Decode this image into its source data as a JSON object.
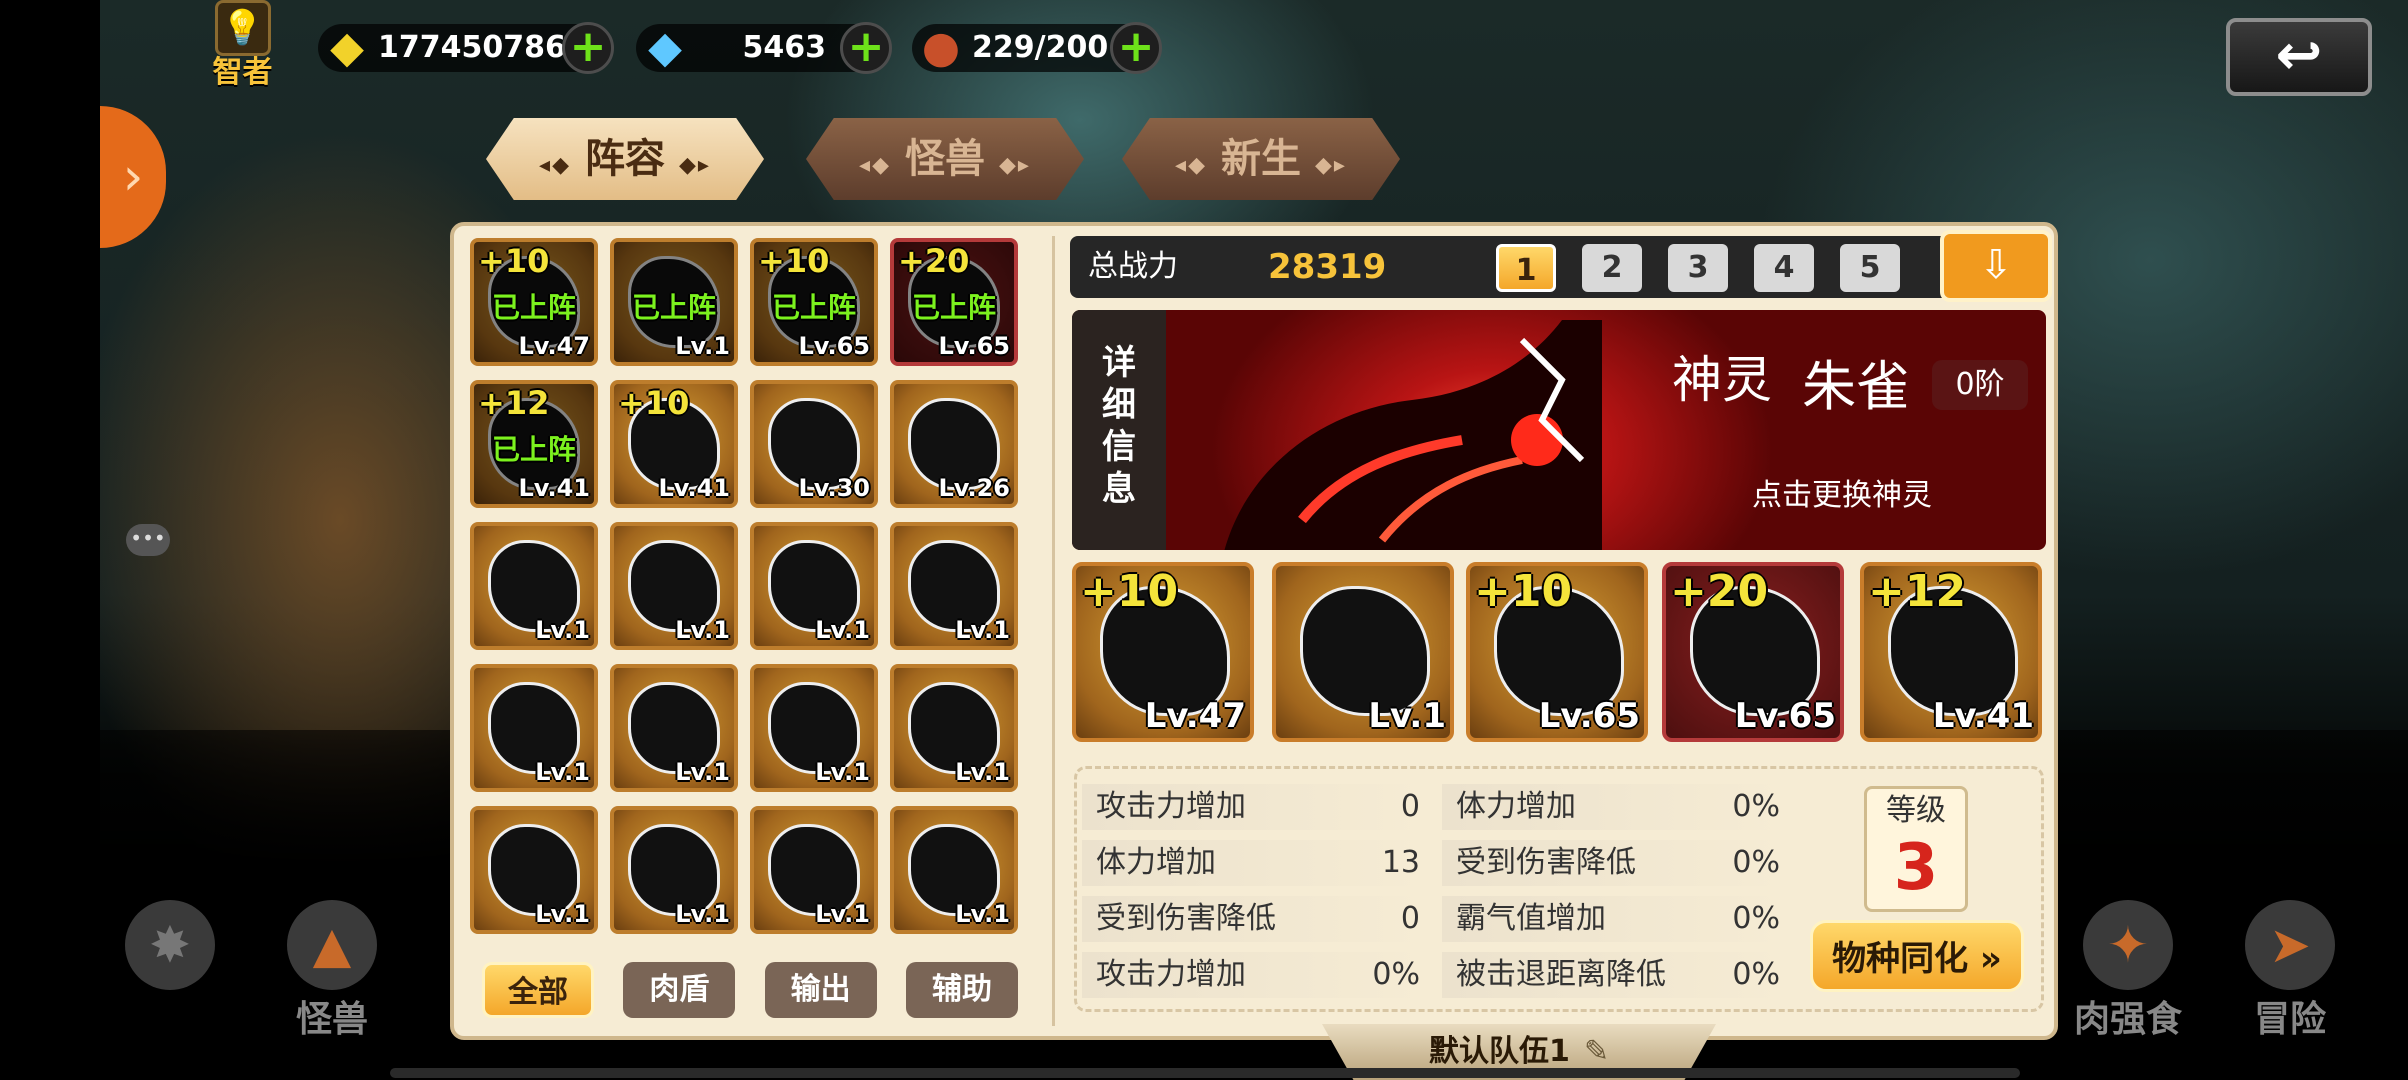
{
  "top": {
    "rank_label": "智者",
    "gold": "177450786",
    "diamonds": "5463",
    "stamina": "229/200"
  },
  "tabs": [
    "阵容",
    "怪兽",
    "新生"
  ],
  "roster": [
    {
      "plus": "+10",
      "lv": "Lv.47",
      "deployed": "已上阵",
      "red": false
    },
    {
      "plus": "",
      "lv": "Lv.1",
      "deployed": "已上阵",
      "red": false
    },
    {
      "plus": "+10",
      "lv": "Lv.65",
      "deployed": "已上阵",
      "red": false
    },
    {
      "plus": "+20",
      "lv": "Lv.65",
      "deployed": "已上阵",
      "red": true
    },
    {
      "plus": "+12",
      "lv": "Lv.41",
      "deployed": "已上阵",
      "red": false
    },
    {
      "plus": "+10",
      "lv": "Lv.41",
      "deployed": "",
      "red": false
    },
    {
      "plus": "",
      "lv": "Lv.30",
      "deployed": "",
      "red": false
    },
    {
      "plus": "",
      "lv": "Lv.26",
      "deployed": "",
      "red": false
    },
    {
      "plus": "",
      "lv": "Lv.1",
      "deployed": "",
      "red": false
    },
    {
      "plus": "",
      "lv": "Lv.1",
      "deployed": "",
      "red": false
    },
    {
      "plus": "",
      "lv": "Lv.1",
      "deployed": "",
      "red": false
    },
    {
      "plus": "",
      "lv": "Lv.1",
      "deployed": "",
      "red": false
    },
    {
      "plus": "",
      "lv": "Lv.1",
      "deployed": "",
      "red": false
    },
    {
      "plus": "",
      "lv": "Lv.1",
      "deployed": "",
      "red": false
    },
    {
      "plus": "",
      "lv": "Lv.1",
      "deployed": "",
      "red": false
    },
    {
      "plus": "",
      "lv": "Lv.1",
      "deployed": "",
      "red": false
    },
    {
      "plus": "",
      "lv": "Lv.1",
      "deployed": "",
      "red": false
    },
    {
      "plus": "",
      "lv": "Lv.1",
      "deployed": "",
      "red": false
    },
    {
      "plus": "",
      "lv": "Lv.1",
      "deployed": "",
      "red": false
    },
    {
      "plus": "",
      "lv": "Lv.1",
      "deployed": "",
      "red": false
    }
  ],
  "filters": [
    "全部",
    "肉盾",
    "输出",
    "辅助"
  ],
  "power": {
    "label": "总战力",
    "value": "28319"
  },
  "team_numbers": [
    "1",
    "2",
    "3",
    "4",
    "5"
  ],
  "spirit": {
    "detail": "详细信息",
    "kind": "神灵",
    "name": "朱雀",
    "stage": "0阶",
    "swap_hint": "点击更换神灵"
  },
  "lineup": [
    {
      "plus": "+10",
      "lv": "Lv.47",
      "red": false
    },
    {
      "plus": "",
      "lv": "Lv.1",
      "red": false
    },
    {
      "plus": "+10",
      "lv": "Lv.65",
      "red": false
    },
    {
      "plus": "+20",
      "lv": "Lv.65",
      "red": true
    },
    {
      "plus": "+12",
      "lv": "Lv.41",
      "red": false
    }
  ],
  "stats_left": [
    {
      "k": "攻击力增加",
      "v": "0"
    },
    {
      "k": "体力增加",
      "v": "13"
    },
    {
      "k": "受到伤害降低",
      "v": "0"
    },
    {
      "k": "攻击力增加",
      "v": "0%"
    }
  ],
  "stats_right": [
    {
      "k": "体力增加",
      "v": "0%"
    },
    {
      "k": "受到伤害降低",
      "v": "0%"
    },
    {
      "k": "霸气值增加",
      "v": "0%"
    },
    {
      "k": "被击退距离降低",
      "v": "0%"
    }
  ],
  "level": {
    "label": "等级",
    "value": "3"
  },
  "assimilate": "物种同化",
  "team_name": "默认队伍1",
  "bottom_nav": [
    "怪兽",
    "肉强食",
    "冒险"
  ]
}
